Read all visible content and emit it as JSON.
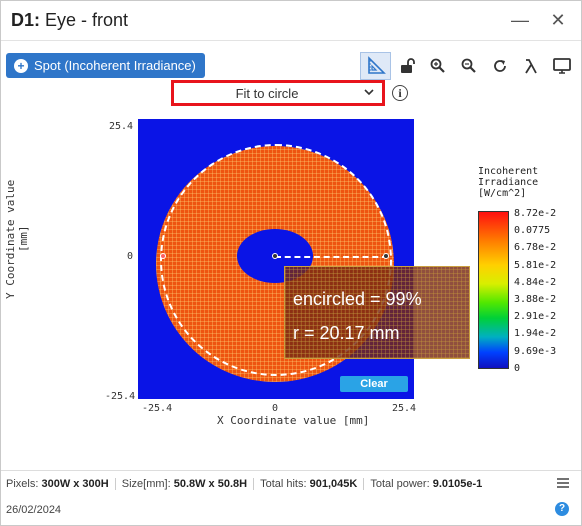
{
  "window": {
    "title_prefix": "D1:",
    "title_rest": " Eye - front"
  },
  "title_controls": {
    "minimize": "—",
    "close": "✕"
  },
  "toolbar": {
    "spot_label": "Spot (Incoherent Irradiance)",
    "tools": [
      "ruler-triangle-icon",
      "unlock-icon",
      "zoom-in-icon",
      "zoom-out-icon",
      "refresh-icon",
      "lambda-icon",
      "monitor-icon"
    ]
  },
  "fit_dropdown": {
    "selected": "Fit to circle"
  },
  "info_label": "i",
  "plot": {
    "xlabel": "X Coordinate value [mm]",
    "ylabel": "Y Coordinate value [mm]",
    "x_ticks": [
      "-25.4",
      "0",
      "25.4"
    ],
    "y_ticks": [
      "25.4",
      "0",
      "-25.4"
    ],
    "overlay": {
      "encircled": "encircled = 99%",
      "radius": "r = 20.17 mm"
    },
    "clear_label": "Clear"
  },
  "legend": {
    "title_lines": [
      "Incoherent",
      "Irradiance",
      "[W/cm^2]"
    ],
    "values": [
      "8.72e-2",
      "0.0775",
      "6.78e-2",
      "5.81e-2",
      "4.84e-2",
      "3.88e-2",
      "2.91e-2",
      "1.94e-2",
      "9.69e-3",
      "0"
    ]
  },
  "colors": {
    "accent": "#2f76c9",
    "plot_bg": "#0a14e6",
    "highlight": "#e8141c",
    "clear_button": "#2aa3e6"
  },
  "footer": {
    "pixels_label": "Pixels:",
    "pixels_value": "300W x 300H",
    "size_label": "Size[mm]:",
    "size_value": "50.8W x 50.8H",
    "hits_label": "Total hits:",
    "hits_value": "901,045K",
    "power_label": "Total power:",
    "power_value": "9.0105e-1",
    "date": "26/02/2024"
  }
}
